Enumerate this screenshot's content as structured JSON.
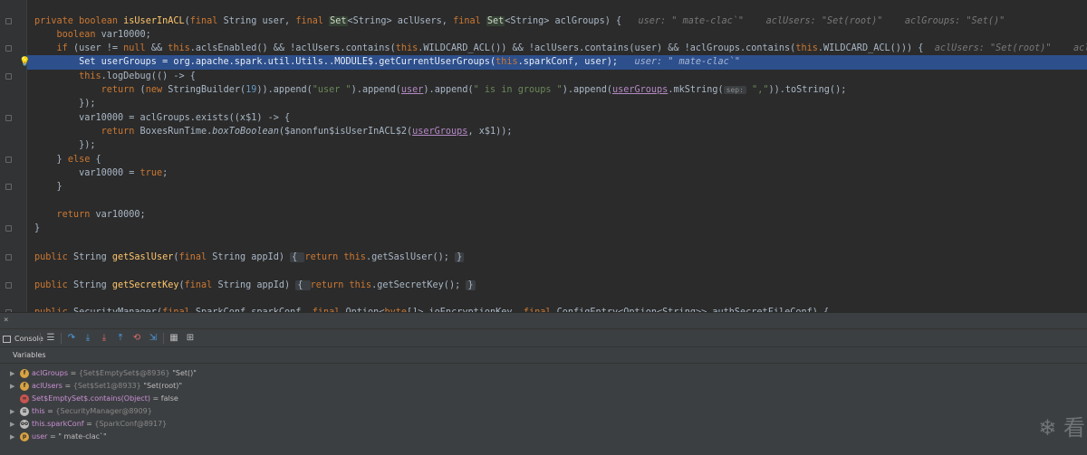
{
  "editor": {
    "lines": [
      {
        "segments": [
          [
            "kw",
            "private "
          ],
          [
            "kw",
            "boolean "
          ],
          [
            "mth",
            "isUserInACL"
          ],
          [
            "",
            "("
          ],
          [
            "kw",
            "final "
          ],
          [
            "",
            "String user, "
          ],
          [
            "kw",
            "final "
          ],
          [
            "hl",
            "Set"
          ],
          [
            "",
            "<String> aclUsers, "
          ],
          [
            "kw",
            "final "
          ],
          [
            "hl",
            "Set"
          ],
          [
            "",
            "<String> aclGroups) {   "
          ],
          [
            "hint",
            "user: \" mate-clac`\"    aclUsers: \"Set(root)\"    aclGroups: \"Set()\""
          ]
        ]
      },
      {
        "segments": [
          [
            "kw",
            "    boolean "
          ],
          [
            "",
            "var10000;"
          ]
        ]
      },
      {
        "segments": [
          [
            "kw",
            "    if "
          ],
          [
            "",
            "(user != "
          ],
          [
            "kw",
            "null "
          ],
          [
            "",
            "&& "
          ],
          [
            "kw",
            "this"
          ],
          [
            "",
            ".aclsEnabled() && !aclUsers.contains("
          ],
          [
            "kw",
            "this"
          ],
          [
            "",
            ".WILDCARD_ACL()) && !aclUsers.contains(user) && !aclGroups.contains("
          ],
          [
            "kw",
            "this"
          ],
          [
            "",
            ".WILDCARD_ACL())) {  "
          ],
          [
            "hint",
            "aclUsers: \"Set(root)\"    aclGroups: \"Set()\""
          ]
        ]
      },
      {
        "segments": [
          [
            "",
            "        Set userGroups = org.apache.spark.util.Utils..MODULE$.getCurrentUserGroups("
          ],
          [
            "kw",
            "this"
          ],
          [
            "",
            ".sparkConf, user);   "
          ],
          [
            "hint",
            "user: \" mate-clac`\""
          ]
        ]
      },
      {
        "segments": [
          [
            "kw",
            "        this"
          ],
          [
            "",
            ".logDebug(() -> {"
          ]
        ]
      },
      {
        "segments": [
          [
            "kw",
            "            return "
          ],
          [
            "",
            "("
          ],
          [
            "kw",
            "new "
          ],
          [
            "",
            "StringBuilder("
          ],
          [
            "num",
            "19"
          ],
          [
            "",
            "))."
          ],
          [
            "",
            "append("
          ],
          [
            "str",
            "\"user \""
          ],
          [
            "",
            ").append("
          ],
          [
            "und",
            "user"
          ],
          [
            "",
            ").append("
          ],
          [
            "str",
            "\" is in groups \""
          ],
          [
            "",
            ").append("
          ],
          [
            "und",
            "userGroups"
          ],
          [
            "",
            ".mkString("
          ],
          [
            "ph",
            "sep:"
          ],
          [
            "str",
            " \",\""
          ],
          [
            "",
            ")).toString();"
          ]
        ]
      },
      {
        "segments": [
          [
            "",
            "        });"
          ]
        ]
      },
      {
        "segments": [
          [
            "",
            "        var10000 = aclGroups.exists((x$1) -> {"
          ]
        ]
      },
      {
        "segments": [
          [
            "kw",
            "            return "
          ],
          [
            "",
            "BoxesRunTime."
          ],
          [
            "ita",
            "boxToBoolean"
          ],
          [
            "",
            "($anonfun$isUserInACL$2("
          ],
          [
            "und",
            "userGroups"
          ],
          [
            "",
            ", x$1));"
          ]
        ]
      },
      {
        "segments": [
          [
            "",
            "        });"
          ]
        ]
      },
      {
        "segments": [
          [
            "",
            "    } "
          ],
          [
            "kw",
            "else "
          ],
          [
            "",
            "{"
          ]
        ]
      },
      {
        "segments": [
          [
            "",
            "        var10000 = "
          ],
          [
            "kw",
            "true"
          ],
          [
            "",
            ";"
          ]
        ]
      },
      {
        "segments": [
          [
            "",
            "    }"
          ]
        ]
      },
      {
        "segments": []
      },
      {
        "segments": [
          [
            "kw",
            "    return "
          ],
          [
            "",
            "var10000;"
          ]
        ]
      },
      {
        "segments": [
          [
            "",
            "}"
          ]
        ]
      },
      {
        "segments": []
      },
      {
        "segments": [
          [
            "kw",
            "public "
          ],
          [
            "",
            "String "
          ],
          [
            "mth",
            "getSaslUser"
          ],
          [
            "",
            "("
          ],
          [
            "kw",
            "final "
          ],
          [
            "",
            "String appId) "
          ],
          [
            "fb",
            "{ "
          ],
          [
            "kw",
            "return "
          ],
          [
            "kw",
            "this"
          ],
          [
            "",
            ".getSaslUser(); "
          ],
          [
            "fb",
            "}"
          ]
        ]
      },
      {
        "segments": []
      },
      {
        "segments": [
          [
            "kw",
            "public "
          ],
          [
            "",
            "String "
          ],
          [
            "mth",
            "getSecretKey"
          ],
          [
            "",
            "("
          ],
          [
            "kw",
            "final "
          ],
          [
            "",
            "String appId) "
          ],
          [
            "fb",
            "{ "
          ],
          [
            "kw",
            "return "
          ],
          [
            "kw",
            "this"
          ],
          [
            "",
            ".getSecretKey(); "
          ],
          [
            "fb",
            "}"
          ]
        ]
      },
      {
        "segments": []
      },
      {
        "segments": [
          [
            "kw",
            "public "
          ],
          [
            "",
            "SecurityManager("
          ],
          [
            "kw",
            "final "
          ],
          [
            "",
            "SparkConf sparkConf, "
          ],
          [
            "kw",
            "final "
          ],
          [
            "",
            "Option<"
          ],
          [
            "kw",
            "byte"
          ],
          [
            "",
            "[]> ioEncryptionKey, "
          ],
          [
            "kw",
            "final "
          ],
          [
            "",
            "ConfigEntry<Option<String>> authSecretFileConf) {"
          ]
        ]
      }
    ]
  },
  "debug": {
    "console_label": "Console",
    "variables_label": "Variables",
    "variables": [
      {
        "icon": "f",
        "icon_color": "#d9a343",
        "name": "aclGroups",
        "eq": " = ",
        "type": "{Set$EmptySet$@8936} ",
        "value": "\"Set()\"",
        "expanded": false
      },
      {
        "icon": "f",
        "icon_color": "#d9a343",
        "name": "aclUsers",
        "eq": " = ",
        "type": "{Set$Set1@8933} ",
        "value": "\"Set(root)\"",
        "expanded": false
      },
      {
        "icon": "∞",
        "icon_color": "#c75450",
        "name": "Set$EmptySet$.contains(Object)",
        "eq": " = ",
        "type": "",
        "value": "false",
        "expanded": false
      },
      {
        "icon": "≡",
        "icon_color": "#bbbbbb",
        "name": "this",
        "eq": " = ",
        "type": "{SecurityManager@8909}",
        "value": "",
        "expanded": false
      },
      {
        "icon": "oo",
        "icon_color": "#bbbbbb",
        "name": "this.sparkConf",
        "eq": " = ",
        "type": "{SparkConf@8917}",
        "value": "",
        "expanded": false
      },
      {
        "icon": "p",
        "icon_color": "#d9a343",
        "name": "user",
        "eq": " = ",
        "type": "",
        "value": "\" mate-clac`\"",
        "expanded": false
      }
    ]
  },
  "watermark": "看"
}
